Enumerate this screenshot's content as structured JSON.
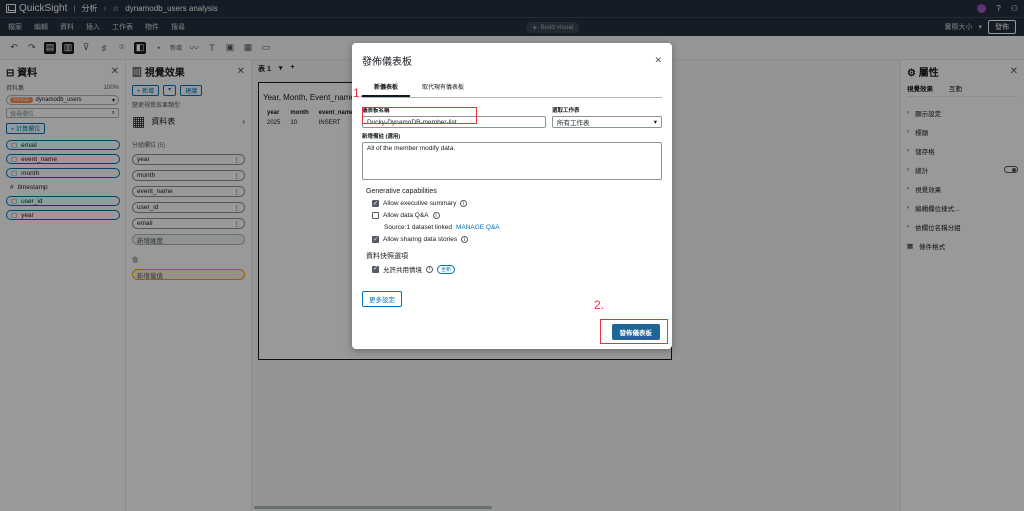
{
  "topbar": {
    "app": "QuickSight",
    "section": "分析",
    "analysis_name": "dynamodb_users analysis"
  },
  "menu": {
    "items": [
      "檔案",
      "編輯",
      "資料",
      "插入",
      "工作表",
      "物件",
      "搜尋"
    ],
    "build_visual": "Build visual",
    "view_size": "實際大小",
    "publish": "發佈"
  },
  "toolbar": {
    "new_label": "新增"
  },
  "data_panel": {
    "title": "資料",
    "dataset_label": "資料集",
    "dataset_pct": "100%",
    "spice": "SPICE",
    "dataset_name": "dynamodb_users",
    "search_placeholder": "搜尋欄位",
    "calc_field": "+ 計算欄位",
    "fields": [
      {
        "name": "email",
        "type": "string"
      },
      {
        "name": "event_name",
        "type": "string"
      },
      {
        "name": "month",
        "type": "string"
      },
      {
        "name": "timestamp",
        "type": "number"
      },
      {
        "name": "user_id",
        "type": "string"
      },
      {
        "name": "year",
        "type": "string"
      }
    ]
  },
  "visual_panel": {
    "title": "視覺效果",
    "add_btn": "+ 新增",
    "suggest_btn": "建議",
    "type_label": "變更視覺效果類型",
    "type_name": "資料表",
    "group_label": "分組欄位 (5)",
    "group_fields": [
      "year",
      "month",
      "event_name",
      "user_id",
      "email"
    ],
    "add_group": "新增維度",
    "value_label": "值",
    "add_value": "新增量值"
  },
  "canvas": {
    "tab": "表 1",
    "visual_title": "Year, Month, Event_name,",
    "columns": [
      "year",
      "month",
      "event_name"
    ],
    "rows": [
      [
        "2025",
        "10",
        "INSERT"
      ]
    ]
  },
  "props_panel": {
    "title": "屬性",
    "tabs": [
      "視覺效果",
      "互動"
    ],
    "items": [
      "顯示設定",
      "標頭",
      "儲存格",
      "總計",
      "視覺效果",
      "編輯欄位樣式...",
      "依欄位名稱分組",
      "條件格式"
    ]
  },
  "modal": {
    "title": "發佈儀表板",
    "tabs": [
      "新儀表板",
      "取代現有儀表板"
    ],
    "name_label": "儀表板名稱",
    "name_value": "Ducky-DynamoDB-member-list",
    "folder_label": "選取工作表",
    "folder_value": "所有工作表",
    "notes_label": "新增備註 (選用)",
    "notes_value": "All of the member modify data.",
    "gen_title": "Generative capabilities",
    "exec_summary": "Allow executive summary",
    "data_qa": "Allow data Q&A",
    "source_text": "Source:1 dataset linked",
    "manage_qa": "MANAGE Q&A",
    "sharing": "Allow sharing data stories",
    "snapshot_title": "資料快照選項",
    "shared_ctx": "允許共用情境",
    "new_badge": "全新",
    "more_settings": "更多設定",
    "publish_btn": "發佈儀表板"
  },
  "annotations": {
    "step1": "1.",
    "step2": "2."
  }
}
